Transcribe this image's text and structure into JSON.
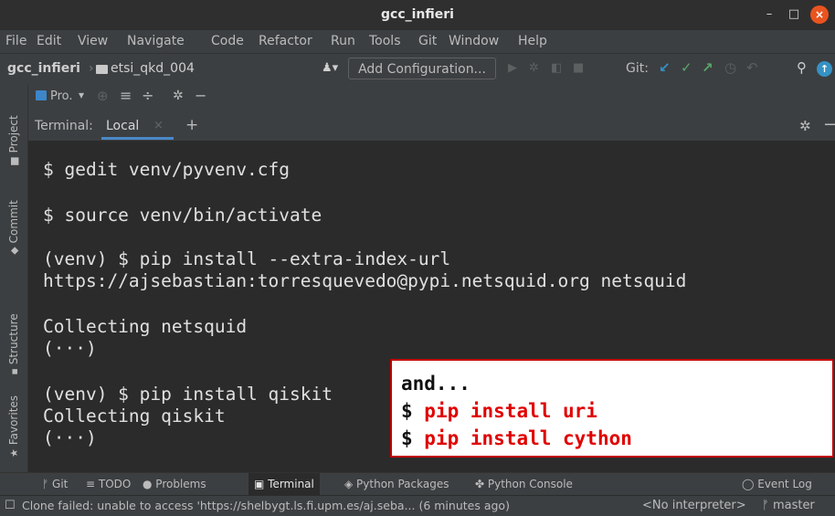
{
  "window": {
    "title": "gcc_infieri",
    "minimize": "–",
    "maximize": "□",
    "close": "×"
  },
  "menu": [
    "File",
    "Edit",
    "View",
    "Navigate",
    "Code",
    "Refactor",
    "Run",
    "Tools",
    "Git",
    "Window",
    "Help"
  ],
  "navbar": {
    "project": "gcc_infieri",
    "folder": "etsi_qkd_004",
    "add_configuration": "Add Configuration...",
    "git_label": "Git:"
  },
  "side_tabs": [
    "Project",
    "Commit",
    "Structure",
    "Favorites"
  ],
  "project_toolbar": {
    "label": "Pro."
  },
  "terminal_tabs": {
    "label": "Terminal:",
    "active_tab": "Local"
  },
  "terminal_lines": [
    "$ gedit venv/pyvenv.cfg",
    "$ source venv/bin/activate",
    "(venv) $ pip install --extra-index-url",
    "https://ajsebastian:torresquevedo@pypi.netsquid.org netsquid",
    "Collecting netsquid",
    "(···)",
    "(venv) $ pip install qiskit",
    "Collecting qiskit",
    "(···)"
  ],
  "callout": {
    "line1": "and...",
    "line2_prefix": "$ ",
    "line2_cmd": "pip install uri",
    "line3_prefix": "$ ",
    "line3_cmd": "pip install cython",
    "accent_color": "#e00000"
  },
  "tool_windows": {
    "git": "Git",
    "todo": "TODO",
    "problems": "Problems",
    "terminal": "Terminal",
    "python_packages": "Python Packages",
    "python_console": "Python Console",
    "event_log": "Event Log"
  },
  "status": {
    "message": "Clone failed: unable to access 'https://shelbygt.ls.fi.upm.es/aj.seba... (6 minutes ago)",
    "interpreter": "<No interpreter>",
    "branch": "master"
  }
}
